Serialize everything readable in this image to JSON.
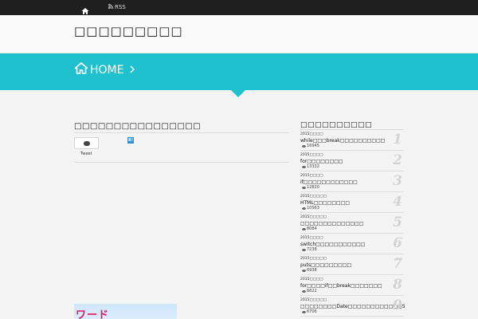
{
  "topbar": {
    "home_icon": "home-icon",
    "rss_label": "RSS",
    "rss_icon": "rss-icon"
  },
  "header": {
    "site_title": "□□□□□□□□□"
  },
  "breadcrumb": {
    "home_label": "HOME",
    "home_icon": "home-icon",
    "separator_icon": "chevron-right-icon"
  },
  "article": {
    "title": "□□□□□□□□□□□□□□□□",
    "tweet_label": "Tweet",
    "hatena_glyph": "B!",
    "thumbnail_text": "ワード"
  },
  "sidebar": {
    "title": "□□□□□□□□□□",
    "items": [
      {
        "rank": "1",
        "date": "2015□□□□",
        "title": "while□□□break□□□□□□□□□□",
        "views": "16945"
      },
      {
        "rank": "2",
        "date": "2015□□□□",
        "title": "for□□□□□□□□",
        "views": "13332"
      },
      {
        "rank": "3",
        "date": "2015□□□□",
        "title": "if□□□□□□□□□□□□",
        "views": "12820"
      },
      {
        "rank": "4",
        "date": "2015□□□□□",
        "title": "HTML□□□□□□□□",
        "views": "10563"
      },
      {
        "rank": "5",
        "date": "2015□□□□□",
        "title": "□□□□□□□□□□□□□□",
        "views": "8084"
      },
      {
        "rank": "6",
        "date": "2015□□□□",
        "title": "switch□□□□□□□□□□□",
        "views": "7238"
      },
      {
        "rank": "7",
        "date": "2015□□□□□",
        "title": "puts□□□□□□□□□",
        "views": "6938"
      },
      {
        "rank": "8",
        "date": "2015□□□□",
        "title": "for□□□□if□□break□□□□□□□",
        "views": "6822"
      },
      {
        "rank": "9",
        "date": "2015□□□□□",
        "title": "□□□□□□□□Date□□□□□□□□□□□□5",
        "views": "6706"
      }
    ]
  },
  "colors": {
    "accent": "#20c1ce",
    "topbar": "#1f1f1f",
    "background": "#f4f4f4"
  }
}
